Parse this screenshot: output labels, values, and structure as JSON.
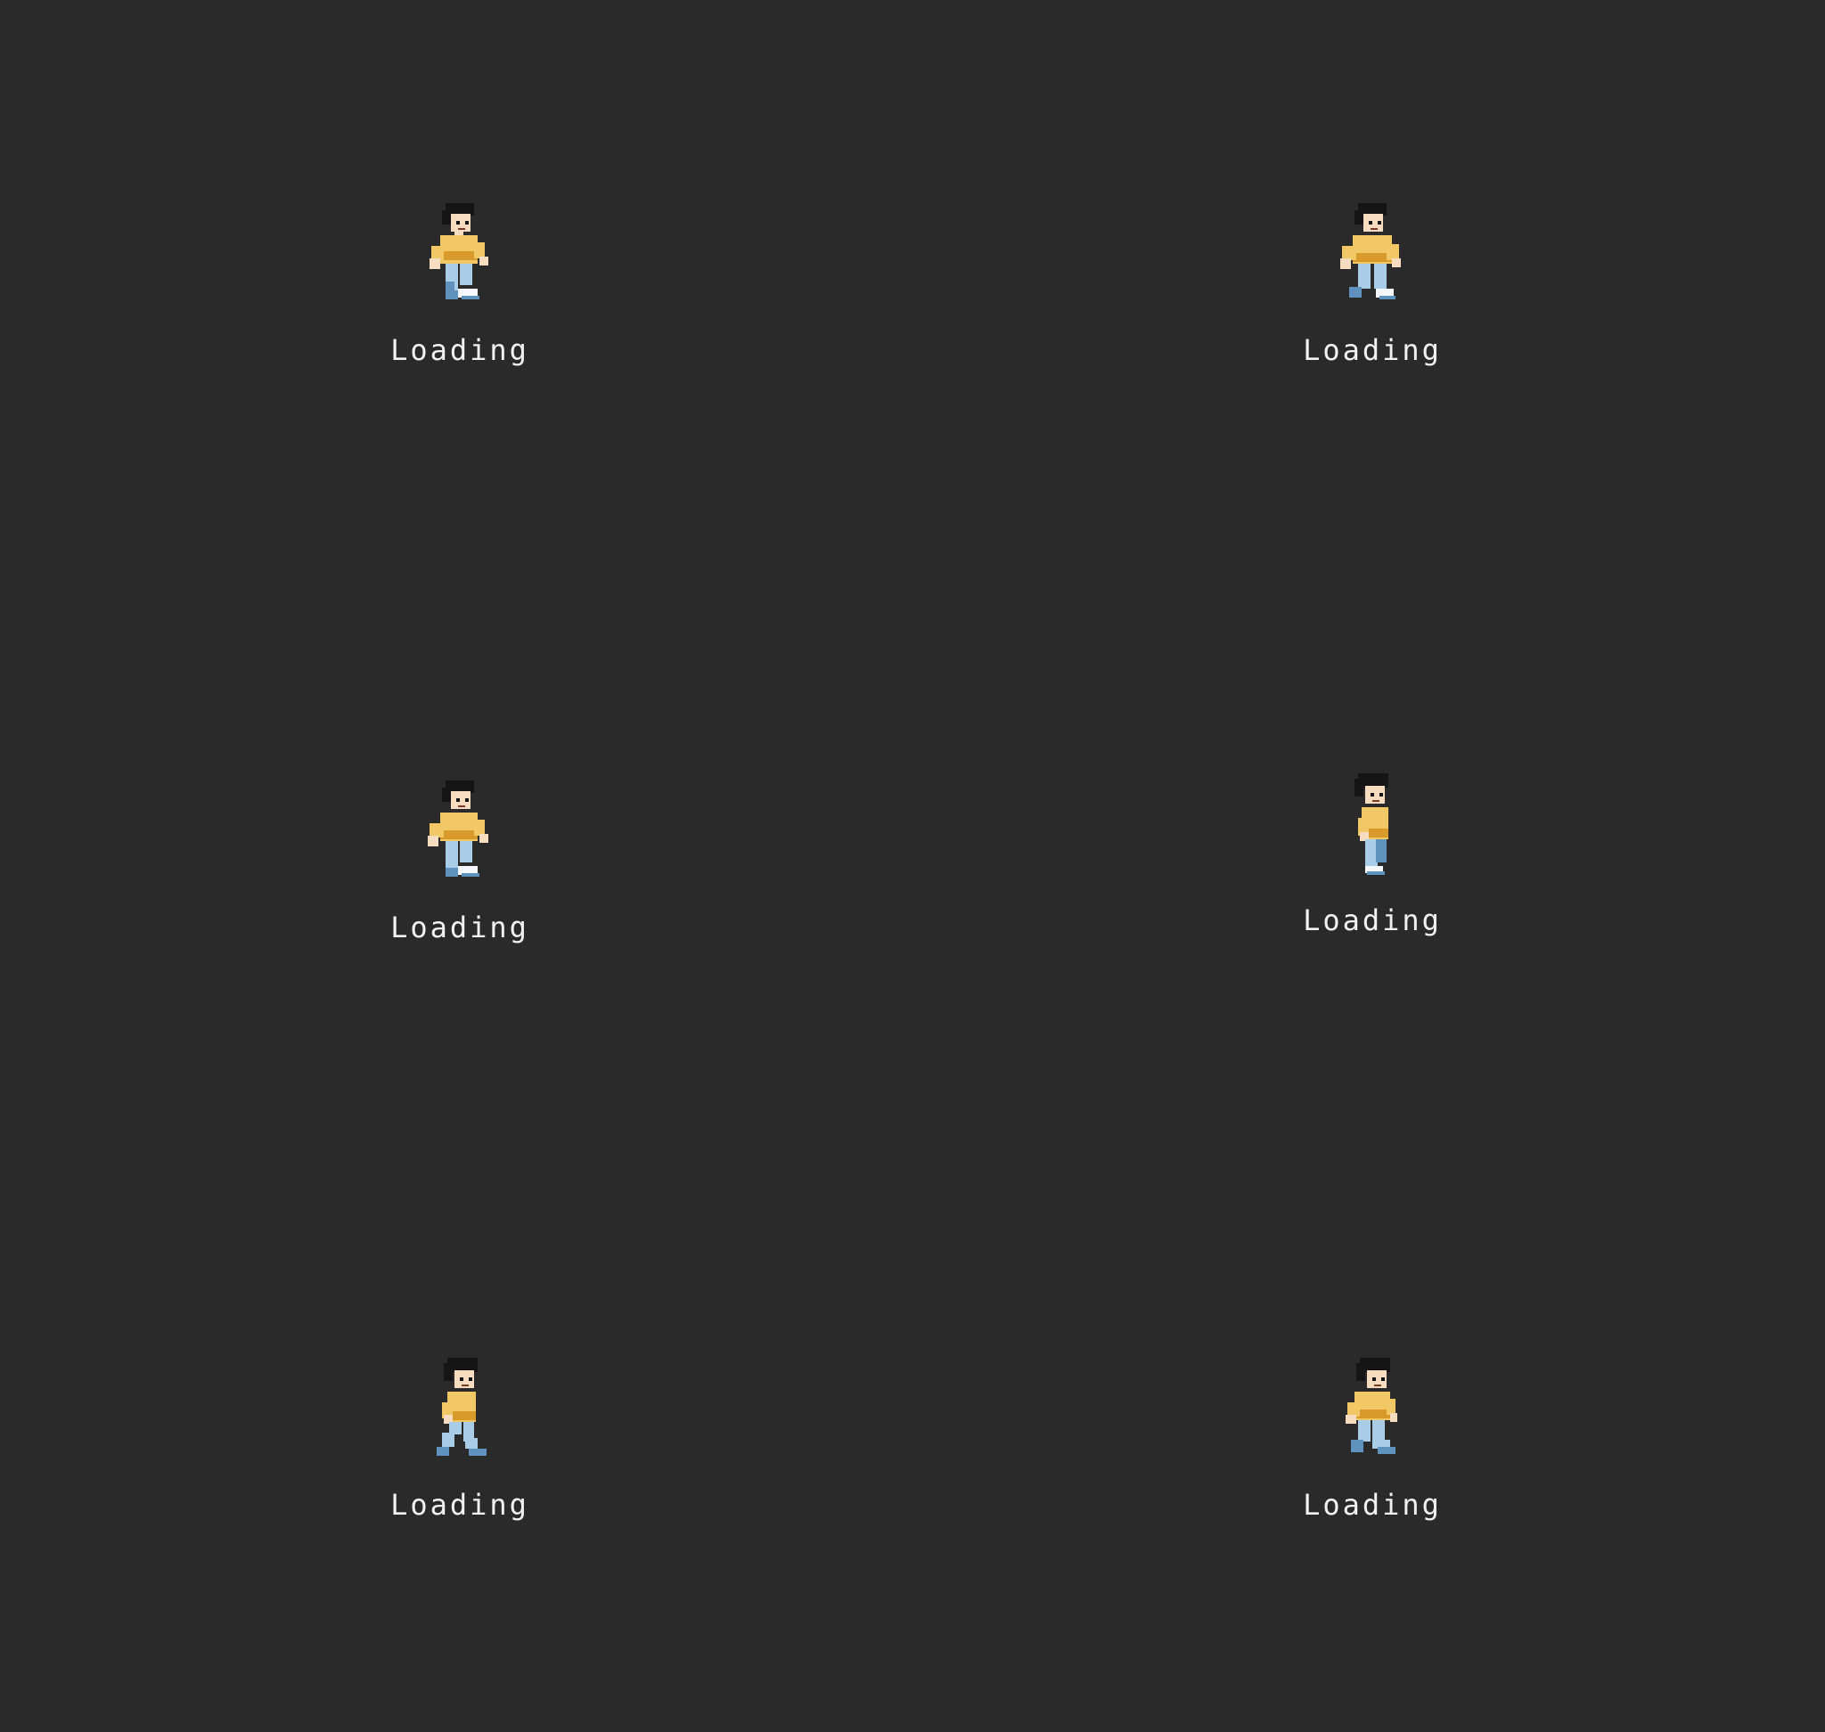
{
  "colors": {
    "background": "#2a2a2a",
    "label": "#f2f2f2",
    "hair": "#151515",
    "skin": "#f6dcc0",
    "shirt": "#f2c766",
    "shirt_shadow": "#d89b2b",
    "jeans": "#a9cde6",
    "jeans_shadow": "#5f93bd",
    "shoes": "#f4f7fb"
  },
  "frames": [
    {
      "label": "Loading",
      "sprite": "walking-boy-sprite"
    },
    {
      "label": "Loading",
      "sprite": "walking-boy-sprite"
    },
    {
      "label": "Loading",
      "sprite": "walking-boy-sprite"
    },
    {
      "label": "Loading",
      "sprite": "walking-boy-sprite"
    },
    {
      "label": "Loading",
      "sprite": "walking-boy-sprite"
    },
    {
      "label": "Loading",
      "sprite": "walking-boy-sprite"
    }
  ]
}
